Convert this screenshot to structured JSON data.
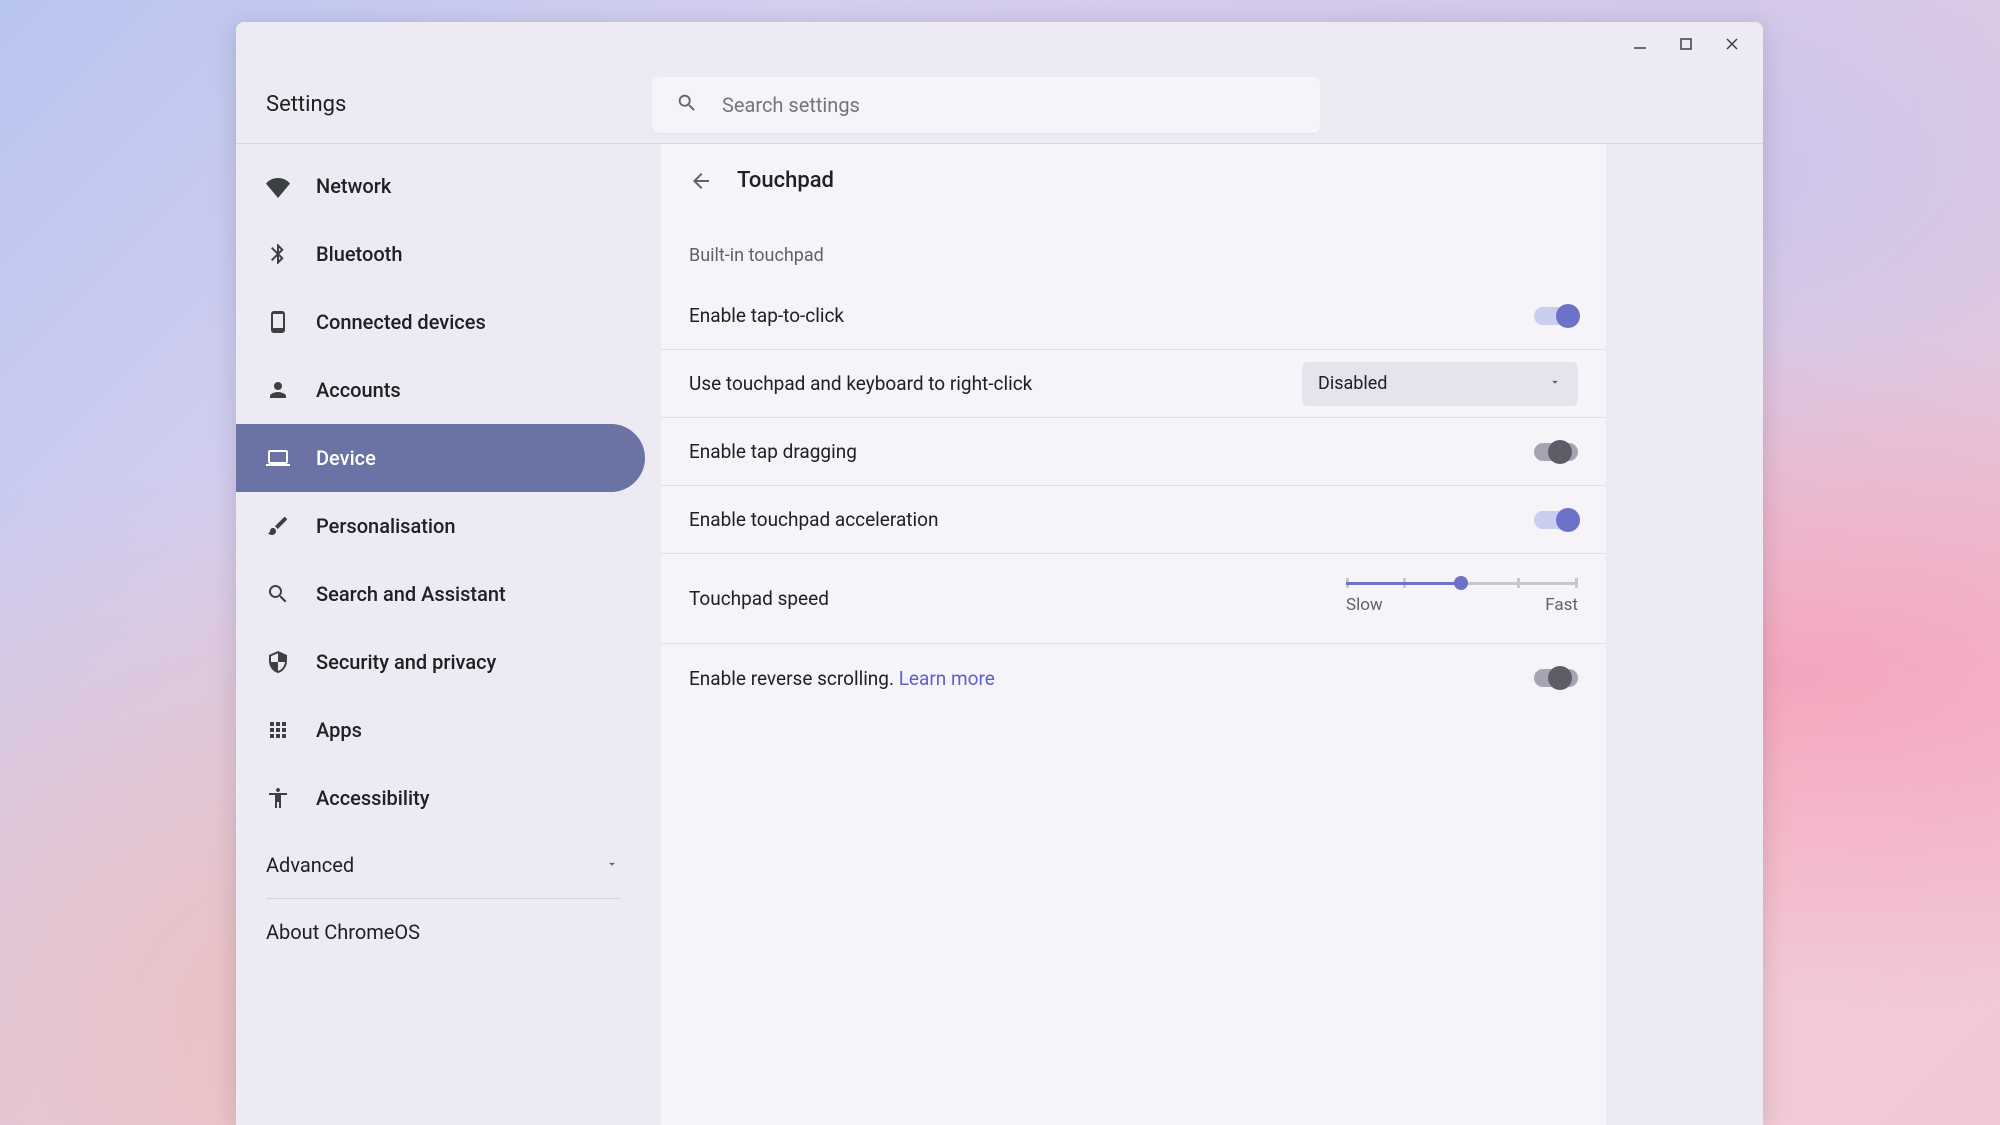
{
  "app_title": "Settings",
  "search": {
    "placeholder": "Search settings"
  },
  "sidebar": {
    "items": [
      {
        "label": "Network",
        "icon": "wifi"
      },
      {
        "label": "Bluetooth",
        "icon": "bluetooth"
      },
      {
        "label": "Connected devices",
        "icon": "phone"
      },
      {
        "label": "Accounts",
        "icon": "person"
      },
      {
        "label": "Device",
        "icon": "laptop",
        "active": true
      },
      {
        "label": "Personalisation",
        "icon": "brush"
      },
      {
        "label": "Search and Assistant",
        "icon": "search"
      },
      {
        "label": "Security and privacy",
        "icon": "shield"
      },
      {
        "label": "Apps",
        "icon": "grid"
      },
      {
        "label": "Accessibility",
        "icon": "accessibility"
      }
    ],
    "advanced": "Advanced",
    "about": "About ChromeOS"
  },
  "page": {
    "title": "Touchpad",
    "section": "Built-in touchpad",
    "rows": {
      "tap_to_click": {
        "label": "Enable tap-to-click",
        "state": "on"
      },
      "right_click": {
        "label": "Use touchpad and keyboard to right-click",
        "value": "Disabled"
      },
      "tap_dragging": {
        "label": "Enable tap dragging",
        "state": "off"
      },
      "acceleration": {
        "label": "Enable touchpad acceleration",
        "state": "on"
      },
      "speed": {
        "label": "Touchpad speed",
        "slow": "Slow",
        "fast": "Fast",
        "value": 2,
        "max": 4
      },
      "reverse": {
        "label": "Enable reverse scrolling. ",
        "link": "Learn more",
        "state": "off"
      }
    }
  }
}
